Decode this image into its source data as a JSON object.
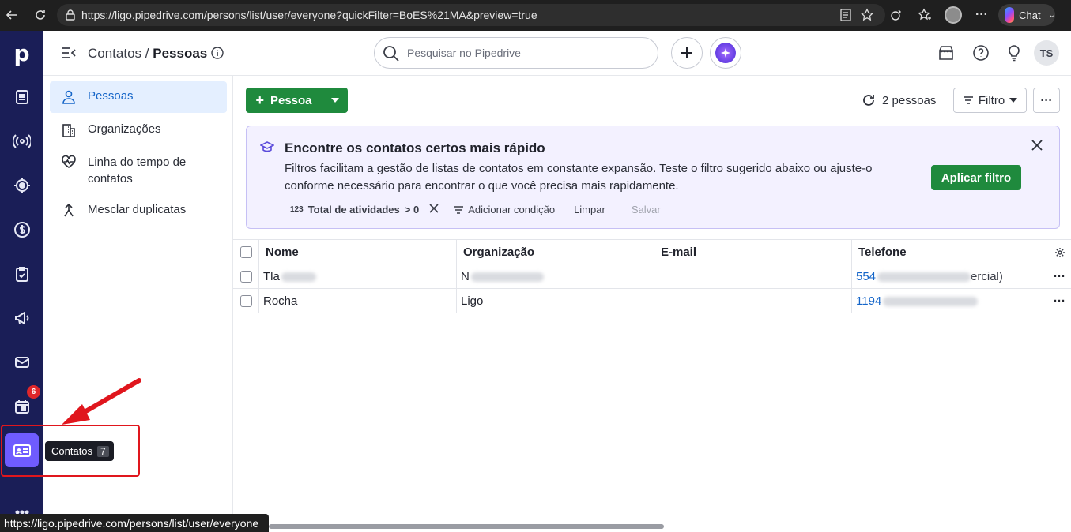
{
  "browser": {
    "url": "https://ligo.pipedrive.com/persons/list/user/everyone?quickFilter=BoES%21MA&preview=true",
    "chat_label": "Chat",
    "status_url": "https://ligo.pipedrive.com/persons/list/user/everyone"
  },
  "rail": {
    "logo": "p",
    "badge_count": "6",
    "tooltip_label": "Contatos",
    "tooltip_count": "7"
  },
  "header": {
    "breadcrumb_parent": "Contatos",
    "breadcrumb_sep": "/",
    "breadcrumb_current": "Pessoas",
    "search_placeholder": "Pesquisar no Pipedrive",
    "avatar_initials": "TS"
  },
  "subnav": {
    "items": [
      {
        "label": "Pessoas"
      },
      {
        "label": "Organizações"
      },
      {
        "label": "Linha do tempo de contatos"
      },
      {
        "label": "Mesclar duplicatas"
      }
    ]
  },
  "toolbar": {
    "add_person_label": "Pessoa",
    "count_label": "2 pessoas",
    "filter_label": "Filtro",
    "more_label": "···"
  },
  "banner": {
    "title": "Encontre os contatos certos mais rápido",
    "text": "Filtros facilitam a gestão de listas de contatos em constante expansão. Teste o filtro sugerido abaixo ou ajuste-o conforme necessário para encontrar o que você precisa mais rapidamente.",
    "condition_label": "Total de atividades",
    "condition_op": "> 0",
    "add_condition_label": "Adicionar condição",
    "clear_label": "Limpar",
    "save_label": "Salvar",
    "apply_label": "Aplicar filtro"
  },
  "table": {
    "columns": [
      "Nome",
      "Organização",
      "E-mail",
      "Telefone"
    ],
    "rows": [
      {
        "name": "Tla",
        "org": "N",
        "email": "",
        "phone": "554",
        "phone_suffix": "ercial)"
      },
      {
        "name": "Rocha",
        "org": "Ligo",
        "email": "",
        "phone": "1194",
        "phone_suffix": ""
      }
    ]
  },
  "colors": {
    "rail_bg": "#1a1e57",
    "accent_green": "#1f8a3d",
    "active_blue": "#1666c9",
    "rail_active": "#6f5cff",
    "annotation_red": "#e0161d"
  }
}
